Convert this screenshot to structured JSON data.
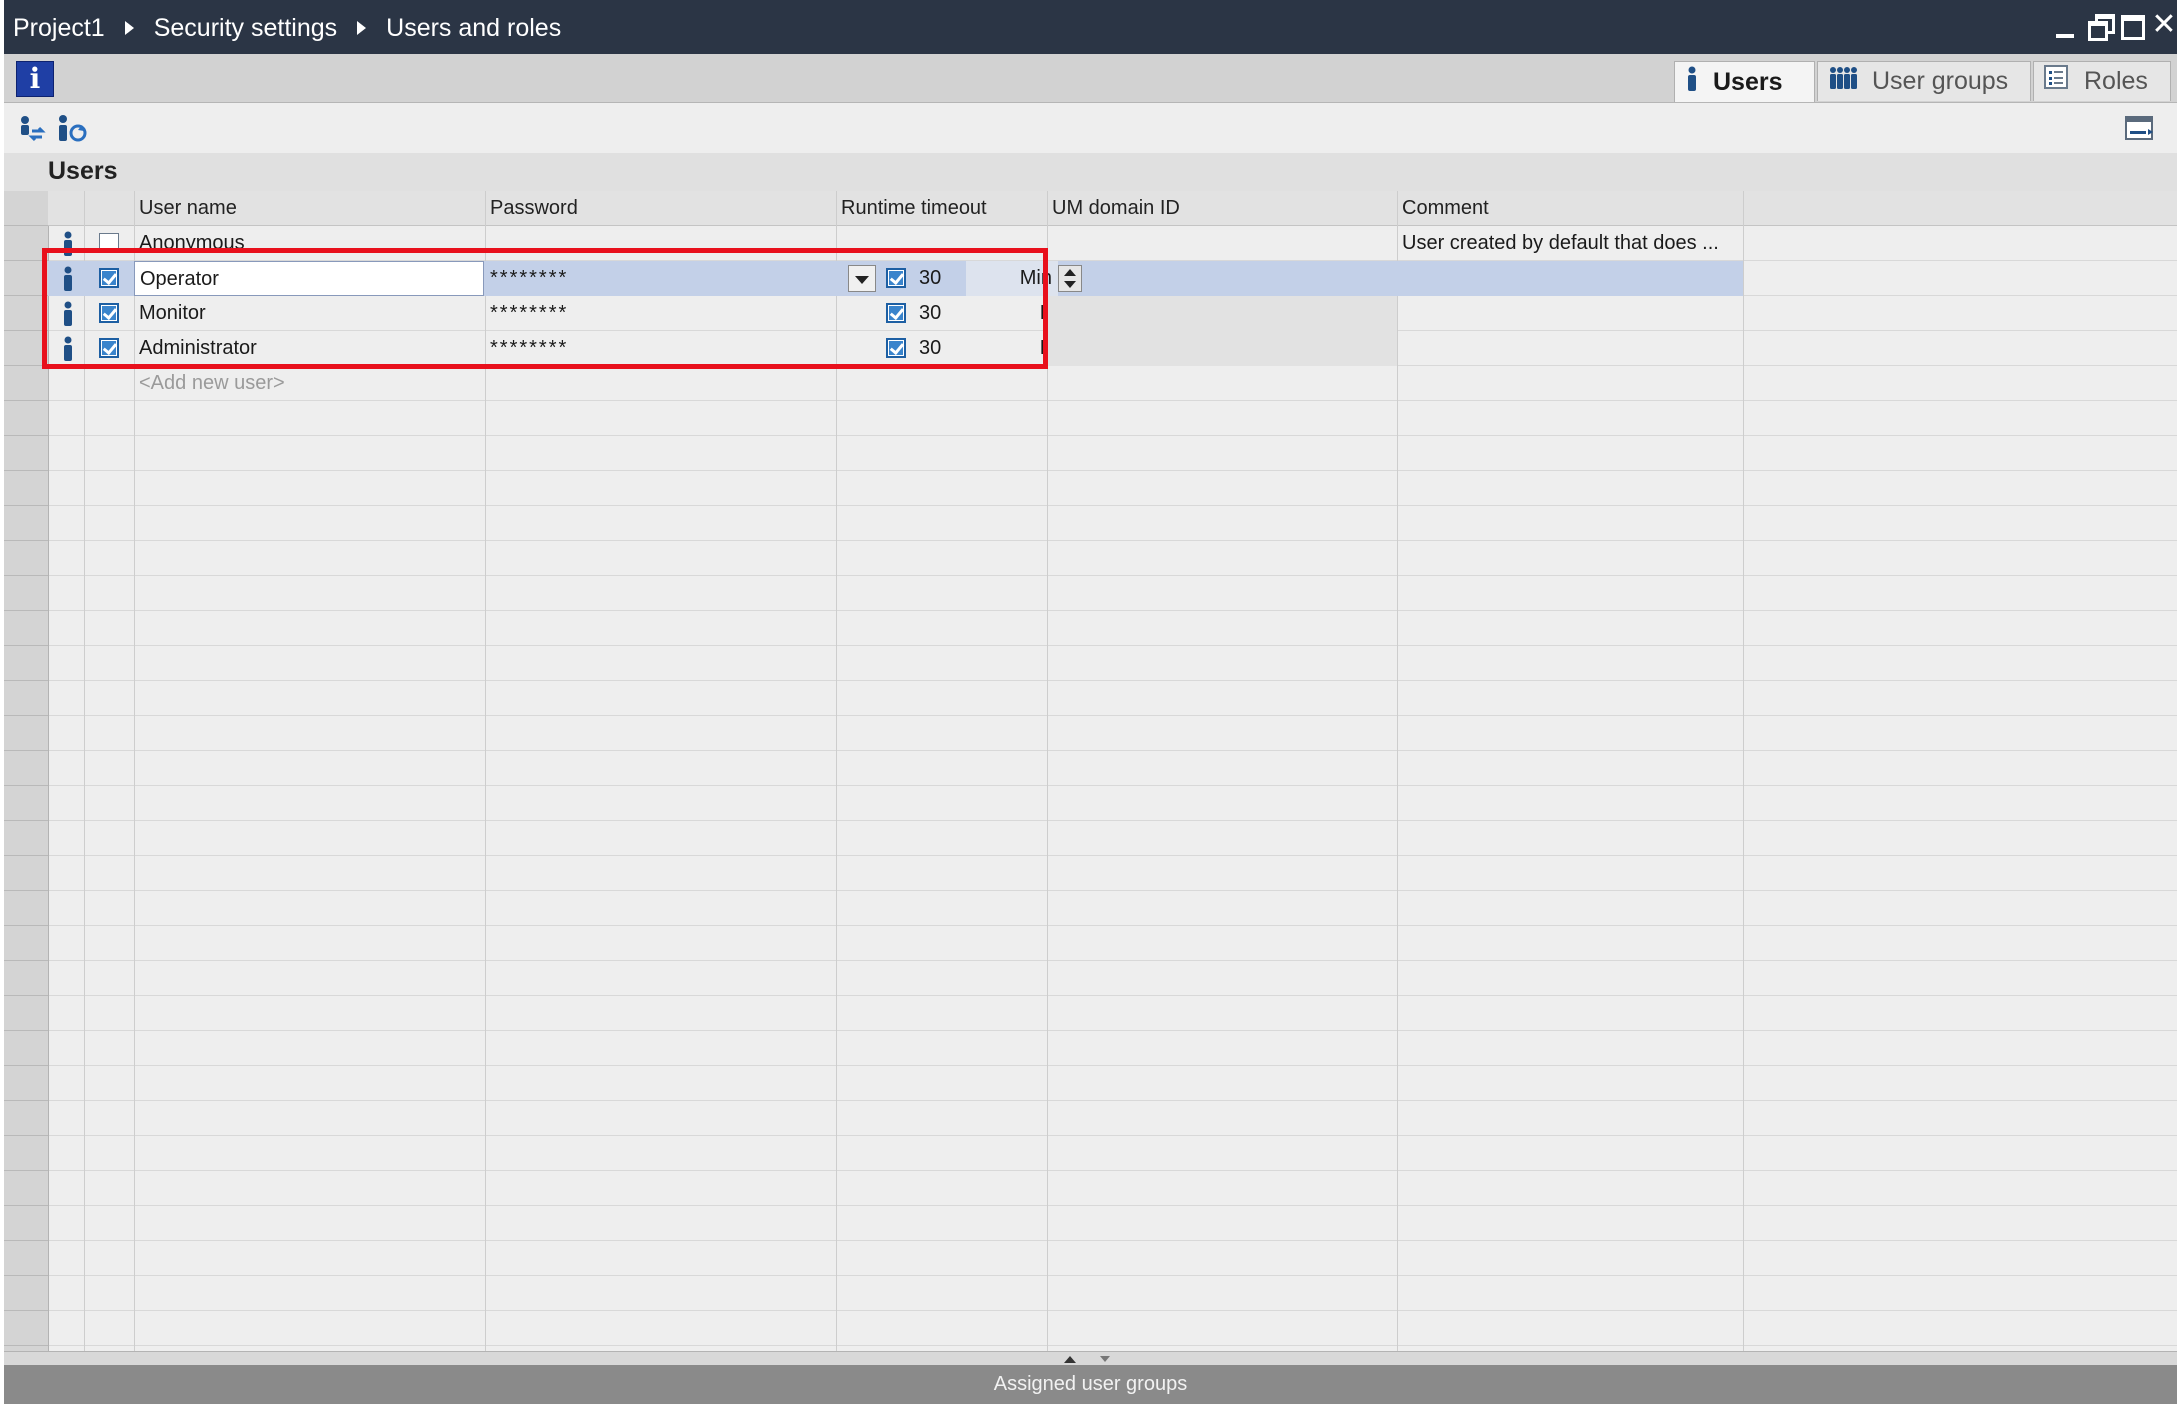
{
  "breadcrumb": [
    "Project1",
    "Security settings",
    "Users and roles"
  ],
  "tabs": {
    "users": "Users",
    "user_groups": "User groups",
    "roles": "Roles"
  },
  "info_button": "i",
  "section_title": "Users",
  "columns": [
    "User name",
    "Password",
    "Runtime timeout",
    "UM domain ID",
    "Comment"
  ],
  "rows": [
    {
      "name": "Anonymous",
      "enabled": false,
      "password": "",
      "timeout": "",
      "unit": "",
      "comment": "User created by default that does ..."
    },
    {
      "name": "Operator",
      "enabled": true,
      "password": "********",
      "timeout_enabled": true,
      "timeout": "30",
      "unit": "Min",
      "comment": ""
    },
    {
      "name": "Monitor",
      "enabled": true,
      "password": "********",
      "timeout_enabled": true,
      "timeout": "30",
      "unit": "Min",
      "comment": ""
    },
    {
      "name": "Administrator",
      "enabled": true,
      "password": "********",
      "timeout_enabled": true,
      "timeout": "30",
      "unit": "Min",
      "comment": ""
    }
  ],
  "add_new_user": "<Add new user>",
  "bottom_panel": "Assigned user groups",
  "colors": {
    "titlebar": "#2b3545",
    "selected_row": "#c3d0e8",
    "highlight": "#e8101c",
    "checkbox": "#3a84cc",
    "user_icon": "#1f4f86"
  }
}
